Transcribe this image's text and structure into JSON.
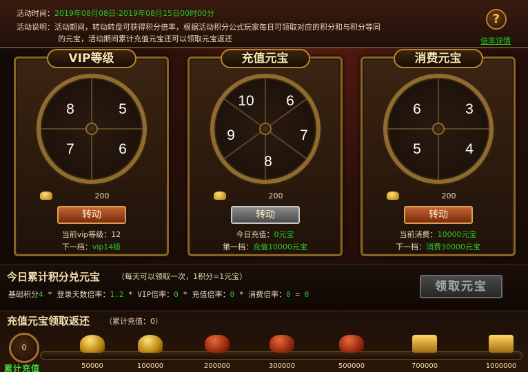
{
  "header": {
    "time_label": "活动时间：",
    "time_value": "2019年08月08日-2019年08月15日00时00分",
    "desc_label": "活动说明：",
    "desc_line1": "活动期间，转动转盘可获得积分倍率，根据活动积分公式玩家每日可领取对应的积分和与积分等同",
    "desc_line2": "的元宝，活动期间累计充值元宝还可以领取元宝返还",
    "help_icon": "?",
    "rate_detail_link": "倍率详情"
  },
  "panels": [
    {
      "title": "VIP等级",
      "wheel_numbers": [
        "8",
        "5",
        "7",
        "6"
      ],
      "gold_amount": "200",
      "spin_label": "转动",
      "info1_label": "当前vip等级：",
      "info1_value": "12",
      "info2_label": "下一档：",
      "info2_value": "vip14级"
    },
    {
      "title": "充值元宝",
      "wheel_numbers": [
        "10",
        "6",
        "9",
        "7",
        "8"
      ],
      "gold_amount": "200",
      "spin_label": "转动",
      "info1_label": "今日充值：",
      "info1_value": "0元宝",
      "info2_label": "第一档：",
      "info2_value": "充值10000元宝"
    },
    {
      "title": "消费元宝",
      "wheel_numbers": [
        "6",
        "3",
        "5",
        "4"
      ],
      "gold_amount": "200",
      "spin_label": "转动",
      "info1_label": "当前消费：",
      "info1_value": "10000元宝",
      "info2_label": "下一档：",
      "info2_value": "消费30000元宝"
    }
  ],
  "exchange": {
    "title": "今日累计积分兑元宝",
    "note": "（每天可以领取一次，1积分=1元宝）",
    "formula": {
      "base_label": "基础积分",
      "base_value": "4",
      "login_label": " * 登录天数倍率：",
      "login_value": "1.2",
      "vip_label": " * VIP倍率：",
      "vip_value": "0",
      "recharge_label": " * 充值倍率：",
      "recharge_value": "0",
      "consume_label": " * 消费倍率：",
      "consume_value": "0",
      "result_label": " = ",
      "result_value": "0"
    },
    "claim_label": "领取元宝"
  },
  "recharge": {
    "title": "充值元宝领取返还",
    "note": "（累计充值：0）",
    "current_value": "0",
    "cumulative_label": "累计充值",
    "progress_fraction": 0,
    "tiers": [
      {
        "amount": "50000",
        "icon": "gold-ingot-icon"
      },
      {
        "amount": "100000",
        "icon": "gold-ingot-icon"
      },
      {
        "amount": "200000",
        "icon": "gold-bag-icon"
      },
      {
        "amount": "300000",
        "icon": "gold-bag-icon"
      },
      {
        "amount": "500000",
        "icon": "gold-pile-icon"
      },
      {
        "amount": "700000",
        "icon": "treasure-chest-icon"
      },
      {
        "amount": "1000000",
        "icon": "treasure-chest-icon"
      }
    ]
  }
}
